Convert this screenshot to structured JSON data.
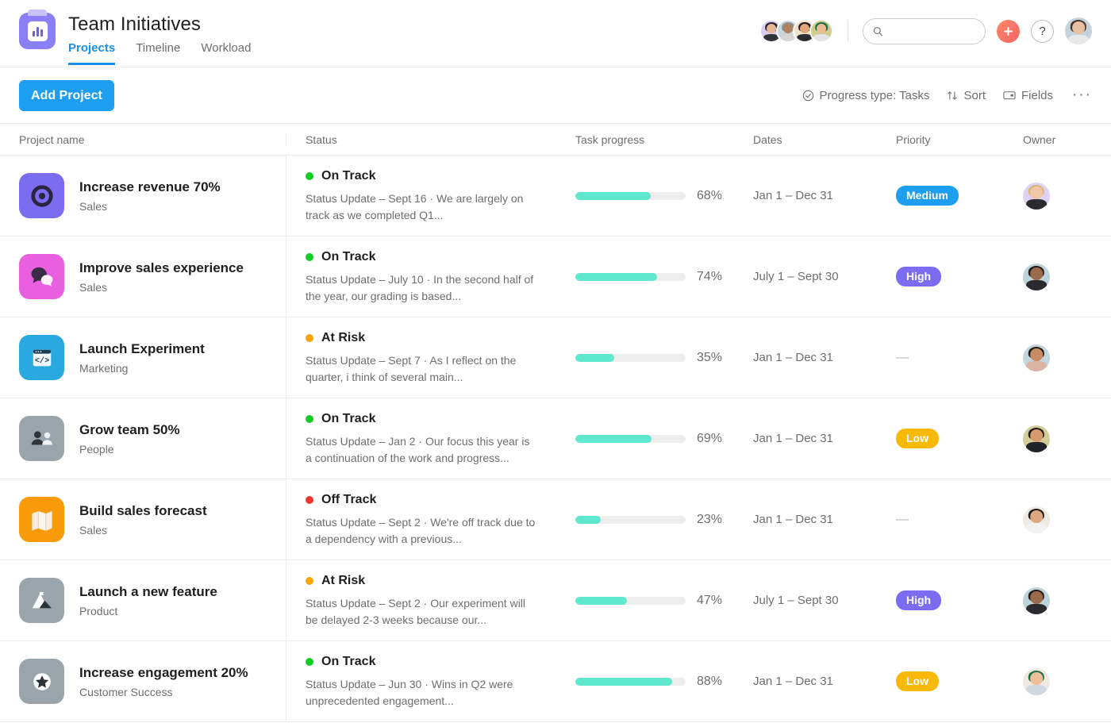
{
  "header": {
    "title": "Team Initiatives",
    "project_icon": "bar-chart-icon",
    "tabs": [
      {
        "label": "Projects",
        "active": true
      },
      {
        "label": "Timeline",
        "active": false
      },
      {
        "label": "Workload",
        "active": false
      }
    ],
    "member_avatars": 4,
    "search": {
      "placeholder": "",
      "value": "",
      "icon": "search-icon"
    },
    "plus_button": {
      "icon": "plus-icon",
      "color": "#f4645f"
    },
    "help_button": {
      "icon": "question-mark-icon",
      "label": "?"
    },
    "user_avatar": "current-user-avatar"
  },
  "toolbar": {
    "add_project_label": "Add Project",
    "add_project_color": "#1d9ef0",
    "progress_type_label": "Progress type: Tasks",
    "progress_type_icon": "check-circle-icon",
    "sort_label": "Sort",
    "sort_icon": "sort-arrows-icon",
    "fields_label": "Fields",
    "fields_icon": "fields-icon",
    "overflow_label": "···"
  },
  "table": {
    "columns": [
      {
        "key": "name",
        "label": "Project name"
      },
      {
        "key": "status",
        "label": "Status"
      },
      {
        "key": "progress",
        "label": "Task progress"
      },
      {
        "key": "dates",
        "label": "Dates"
      },
      {
        "key": "priority",
        "label": "Priority"
      },
      {
        "key": "owner",
        "label": "Owner"
      }
    ],
    "status_colors": {
      "On Track": "#14cc26",
      "At Risk": "#f6a609",
      "Off Track": "#f0382a"
    },
    "priority_colors": {
      "Medium": "#1d9ef0",
      "High": "#7a6df0",
      "Low": "#f8b908"
    },
    "progress_bar_color": "#5fe8ce",
    "rows": [
      {
        "name": "Increase revenue 70%",
        "team": "Sales",
        "icon": "target-icon",
        "icon_bg": "#7b6cf0",
        "status": "On Track",
        "status_update": "Status Update – Sept 16 · We are largely on track as we completed Q1...",
        "progress": 68,
        "progress_label": "68%",
        "dates": "Jan 1 – Dec 31",
        "priority": "Medium",
        "owner": "blonde-woman-avatar"
      },
      {
        "name": "Improve sales experience",
        "team": "Sales",
        "icon": "speech-bubbles-icon",
        "icon_bg": "#e85fe0",
        "status": "On Track",
        "status_update": "Status Update – July 10 · In the second half of the year, our grading is based...",
        "progress": 74,
        "progress_label": "74%",
        "dates": "July 1 – Sept 30",
        "priority": "High",
        "owner": "dark-hair-woman-avatar"
      },
      {
        "name": "Launch Experiment",
        "team": "Marketing",
        "icon": "code-window-icon",
        "icon_bg": "#29a9e0",
        "status": "At Risk",
        "status_update": "Status Update – Sept 7 · As I reflect on the quarter, i think of several main...",
        "progress": 35,
        "progress_label": "35%",
        "dates": "Jan 1 – Dec 31",
        "priority": "",
        "owner": "glasses-man-avatar"
      },
      {
        "name": "Grow team 50%",
        "team": "People",
        "icon": "people-icon",
        "icon_bg": "#9aa5ab",
        "status": "On Track",
        "status_update": "Status Update – Jan 2 · Our focus this year is a continuation of the work and progress...",
        "progress": 69,
        "progress_label": "69%",
        "dates": "Jan 1 – Dec 31",
        "priority": "Low",
        "owner": "short-hair-man-avatar"
      },
      {
        "name": "Build sales forecast",
        "team": "Sales",
        "icon": "map-icon",
        "icon_bg": "#f89a09",
        "status": "Off Track",
        "status_update": "Status Update – Sept 2 · We're off track due to a dependency with a previous...",
        "progress": 23,
        "progress_label": "23%",
        "dates": "Jan 1 – Dec 31",
        "priority": "",
        "owner": "long-hair-woman-avatar"
      },
      {
        "name": "Launch a new feature",
        "team": "Product",
        "icon": "mountain-flag-icon",
        "icon_bg": "#9aa5ab",
        "status": "At Risk",
        "status_update": "Status Update – Sept 2 · Our experiment will be delayed 2-3 weeks because our...",
        "progress": 47,
        "progress_label": "47%",
        "dates": "July 1 – Sept 30",
        "priority": "High",
        "owner": "dark-hair-woman-2-avatar"
      },
      {
        "name": "Increase engagement 20%",
        "team": "Customer Success",
        "icon": "star-circle-icon",
        "icon_bg": "#9aa5ab",
        "status": "On Track",
        "status_update": "Status Update – Jun 30 · Wins in Q2 were unprecedented engagement...",
        "progress": 88,
        "progress_label": "88%",
        "dates": "Jan 1 – Dec 31",
        "priority": "Low",
        "owner": "green-hat-person-avatar"
      }
    ]
  }
}
